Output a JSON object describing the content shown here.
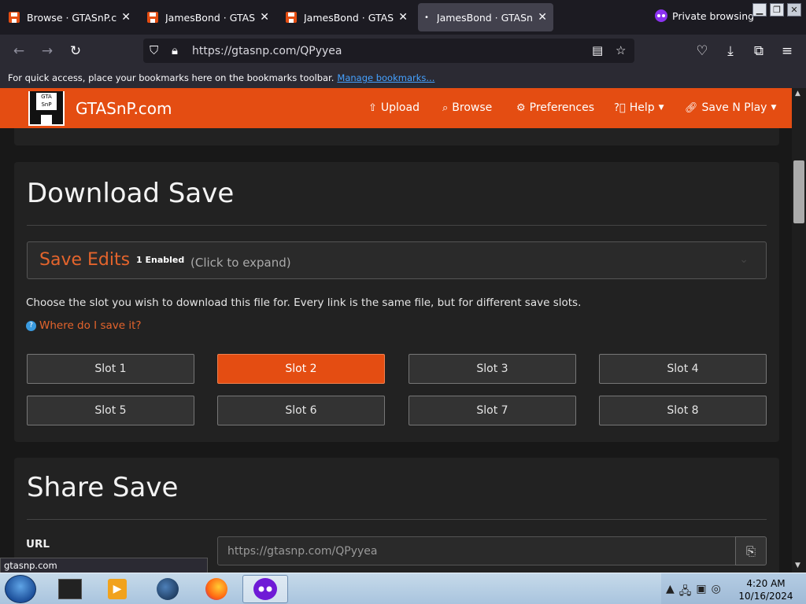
{
  "browser": {
    "tabs": [
      {
        "title": "Browse · GTASnP.com",
        "active": false
      },
      {
        "title": "JamesBond · GTASnP.c",
        "active": false
      },
      {
        "title": "JamesBond · GTASnP.c",
        "active": false
      },
      {
        "title": "JamesBond · GTASnP.c",
        "active": true
      }
    ],
    "private_label": "Private browsing",
    "url": "https://gtasnp.com/QPyyea",
    "bookmarks_text": "For quick access, place your bookmarks here on the bookmarks toolbar.",
    "bookmarks_link": "Manage bookmarks...",
    "status_url": "gtasnp.com"
  },
  "site": {
    "brand": "GTASnP.com",
    "logo_text": "GTA SnP",
    "nav": [
      {
        "label": "Upload",
        "icon": "upload-icon"
      },
      {
        "label": "Browse",
        "icon": "search-icon"
      },
      {
        "label": "Preferences",
        "icon": "gear-icon"
      },
      {
        "label": "Help",
        "icon": "question-icon",
        "dropdown": true
      },
      {
        "label": "Save N Play",
        "icon": "link-icon",
        "dropdown": true
      }
    ],
    "accent_color": "#e44d12"
  },
  "download": {
    "title": "Download Save",
    "save_edits": {
      "title": "Save Edits",
      "badge": "1 Enabled",
      "hint": "(Click to expand)"
    },
    "instruction": "Choose the slot you wish to download this file for. Every link is the same file, but for different save slots.",
    "where_link": "Where do I save it?",
    "slots": [
      "Slot 1",
      "Slot 2",
      "Slot 3",
      "Slot 4",
      "Slot 5",
      "Slot 6",
      "Slot 7",
      "Slot 8"
    ],
    "selected_slot": "Slot 2"
  },
  "share": {
    "title": "Share Save",
    "url_label": "URL",
    "url_value": "https://gtasnp.com/QPyyea"
  },
  "taskbar": {
    "time": "4:20 AM",
    "date": "10/16/2024"
  }
}
